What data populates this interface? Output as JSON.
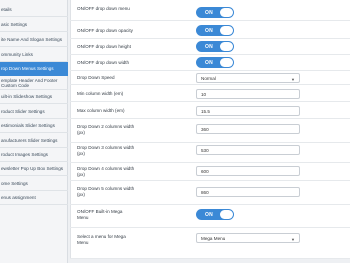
{
  "sidebar": {
    "items": [
      {
        "label": "etails"
      },
      {
        "label": "asic Settings"
      },
      {
        "label": "ite Name And Slogan Settings"
      },
      {
        "label": "ommunity Links"
      },
      {
        "label": "rop Down Menus Settings"
      },
      {
        "label": "emplate Header And Footer Custom Code"
      },
      {
        "label": "uilt-in Slideshow Settings"
      },
      {
        "label": "roduct Slider Settings"
      },
      {
        "label": "estimonials Slider Settings"
      },
      {
        "label": "anufacturers Slider Settings"
      },
      {
        "label": "roduct Images Settings"
      },
      {
        "label": "ewsletter Pop Up Box Settings"
      },
      {
        "label": "ome Settings"
      },
      {
        "label": "enus assignment"
      }
    ]
  },
  "settings": {
    "menu_toggle": {
      "label": "ON/OFF drop down menu",
      "state": "ON"
    },
    "opacity_toggle": {
      "label": "ON/OFF drop down opacity",
      "state": "ON"
    },
    "height_toggle": {
      "label": "ON/OFF drop down height",
      "state": "ON"
    },
    "width_toggle": {
      "label": "ON/OFF drop down width",
      "state": "ON"
    },
    "speed": {
      "label": "Drop Down Speed",
      "value": "Normal"
    },
    "min_width": {
      "label": "Min column width (em)",
      "value": "10"
    },
    "max_width": {
      "label": "Max column width (em)",
      "value": "15.5"
    },
    "col2_width": {
      "label": "Drop Down 2 columns width (px)",
      "value": "360"
    },
    "col3_width": {
      "label": "Drop Down 3 columns width (px)",
      "value": "530"
    },
    "col4_width": {
      "label": "Drop Down 4 columns width (px)",
      "value": "600"
    },
    "col5_width": {
      "label": "Drop Down 5 columns width (px)",
      "value": "860"
    },
    "mega_toggle": {
      "label": "ON/OFF Built-in Mega Menu",
      "state": "ON"
    },
    "mega_select": {
      "label": "Select a menu for Mega Menu",
      "value": "Mega Menu"
    }
  },
  "colors": {
    "accent": "#3b89d6"
  },
  "icons": {
    "select_caret": "caret-down-icon"
  }
}
